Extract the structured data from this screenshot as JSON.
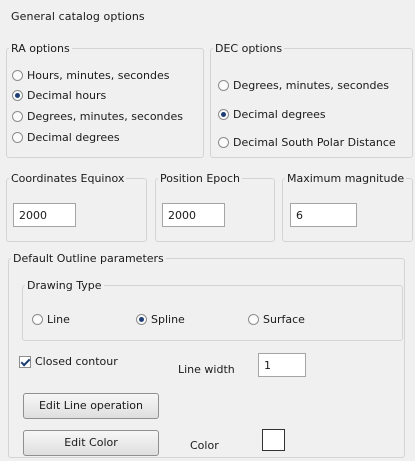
{
  "title": "General catalog options",
  "ra_options": {
    "legend": "RA options",
    "items": [
      {
        "label": "Hours, minutes, secondes",
        "checked": false
      },
      {
        "label": "Decimal hours",
        "checked": true
      },
      {
        "label": "Degrees, minutes, secondes",
        "checked": false
      },
      {
        "label": "Decimal degrees",
        "checked": false
      }
    ]
  },
  "dec_options": {
    "legend": "DEC options",
    "items": [
      {
        "label": "Degrees, minutes, secondes",
        "checked": false
      },
      {
        "label": "Decimal degrees",
        "checked": true
      },
      {
        "label": "Decimal South Polar Distance",
        "checked": false
      }
    ]
  },
  "coordinates_equinox": {
    "legend": "Coordinates Equinox",
    "value": "2000"
  },
  "position_epoch": {
    "legend": "Position Epoch",
    "value": "2000"
  },
  "maximum_magnitude": {
    "legend": "Maximum magnitude",
    "value": "6"
  },
  "outline": {
    "legend": "Default Outline parameters",
    "drawing_type": {
      "legend": "Drawing Type",
      "items": [
        {
          "label": "Line",
          "checked": false
        },
        {
          "label": "Spline",
          "checked": true
        },
        {
          "label": "Surface",
          "checked": false
        }
      ]
    },
    "closed_contour": {
      "label": "Closed contour",
      "checked": true
    },
    "line_width": {
      "label": "Line width",
      "value": "1"
    },
    "edit_line_button": "Edit Line operation",
    "edit_color_button": "Edit Color",
    "color_label": "Color",
    "color_value": "#ffffff"
  }
}
